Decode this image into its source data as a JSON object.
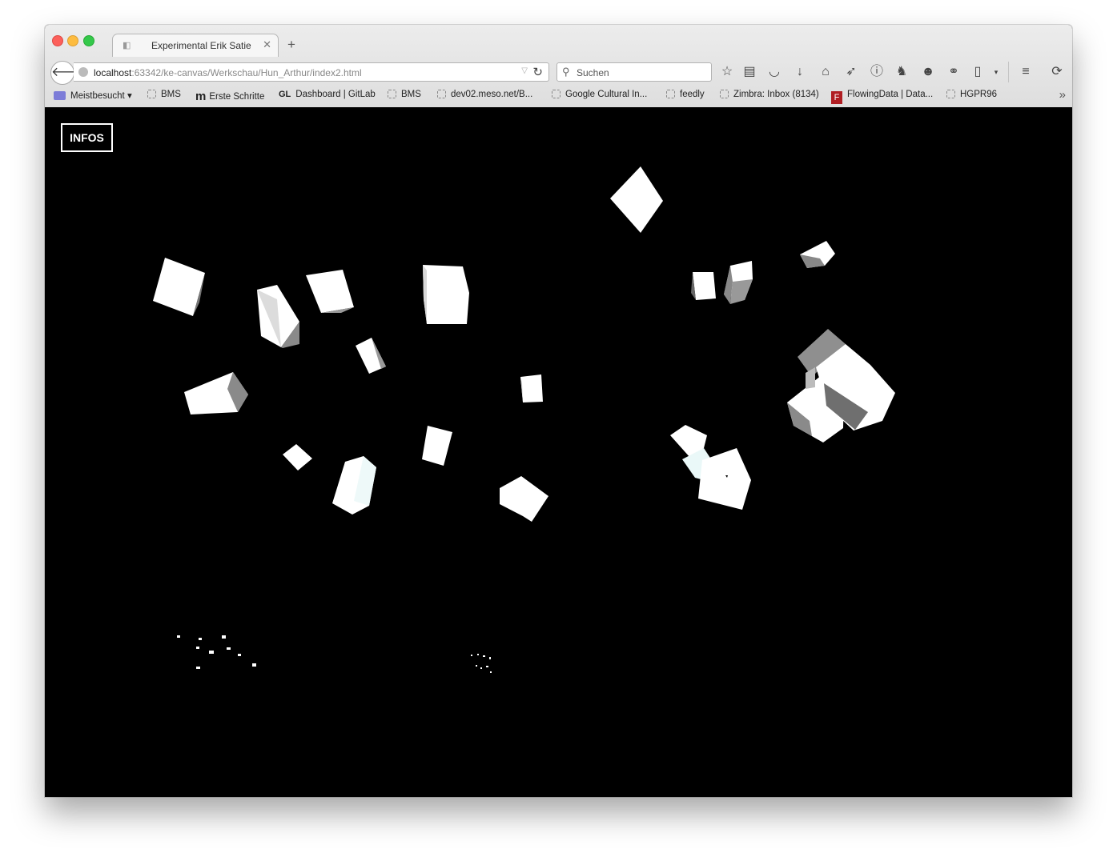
{
  "browser": {
    "tab_title": "Experimental Erik Satie",
    "new_tab_label": "+",
    "url_host": "localhost",
    "url_path": ":63342/ke-canvas/Werkschau/Hun_Arthur/index2.html",
    "search_placeholder": "Suchen"
  },
  "bookmarks": [
    {
      "label": "Meistbesucht ▾",
      "icon": "folder-icon"
    },
    {
      "label": "BMS",
      "icon": "page-icon"
    },
    {
      "label": "Erste Schritte",
      "icon": "m-logo-icon"
    },
    {
      "label": "Dashboard | GitLab",
      "icon": "gitlab-icon"
    },
    {
      "label": "BMS",
      "icon": "page-icon"
    },
    {
      "label": "dev02.meso.net/B...",
      "icon": "page-icon"
    },
    {
      "label": "Google Cultural In...",
      "icon": "page-icon"
    },
    {
      "label": "feedly",
      "icon": "page-icon"
    },
    {
      "label": "Zimbra: Inbox (8134)",
      "icon": "page-icon"
    },
    {
      "label": "FlowingData | Data...",
      "icon": "flowingdata-icon"
    },
    {
      "label": "HGPR96",
      "icon": "page-icon"
    }
  ],
  "toolbar_icons": [
    "bookmark-star-icon",
    "reading-list-icon",
    "pocket-icon",
    "download-icon",
    "home-icon",
    "send-icon",
    "info-icon",
    "addon-icon",
    "chat-icon",
    "extension-icon",
    "clipboard-icon",
    "menu-icon",
    "sync-icon"
  ],
  "page": {
    "infos_label": "INFOS"
  },
  "colors": {
    "background": "#000000",
    "cube_face": "#ffffff",
    "cube_side": "#8a8a8a",
    "cube_tint": "#eaf8f8"
  }
}
